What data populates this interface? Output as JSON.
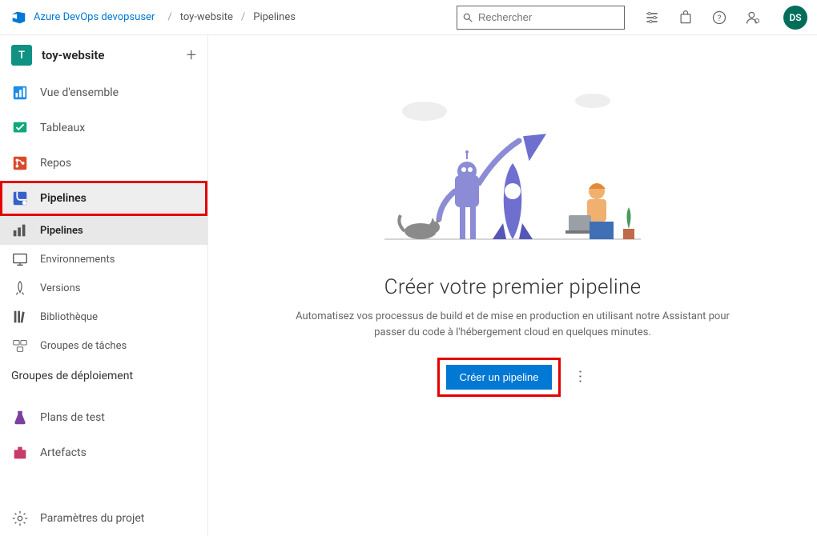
{
  "header": {
    "org": "Azure DevOps devopsuser",
    "breadcrumbs": [
      "toy-website",
      "Pipelines"
    ],
    "search_placeholder": "Rechercher",
    "avatar_initials": "DS"
  },
  "project": {
    "initial": "T",
    "name": "toy-website"
  },
  "nav": {
    "overview": "Vue d'ensemble",
    "boards": "Tableaux",
    "repos": "Repos",
    "pipelines": "Pipelines",
    "testplans": "Plans de test",
    "artifacts": "Artefacts",
    "settings": "Paramètres du projet"
  },
  "subnav": {
    "pipelines": "Pipelines",
    "environments": "Environnements",
    "releases": "Versions",
    "library": "Bibliothèque",
    "taskgroups": "Groupes de tâches",
    "deploymentgroups": "Groupes de déploiement"
  },
  "empty_state": {
    "title": "Créer votre premier pipeline",
    "subtitle": "Automatisez vos processus de build et de mise en production en utilisant notre Assistant pour passer du code à l'hébergement cloud en quelques minutes.",
    "cta": "Créer un pipeline"
  }
}
